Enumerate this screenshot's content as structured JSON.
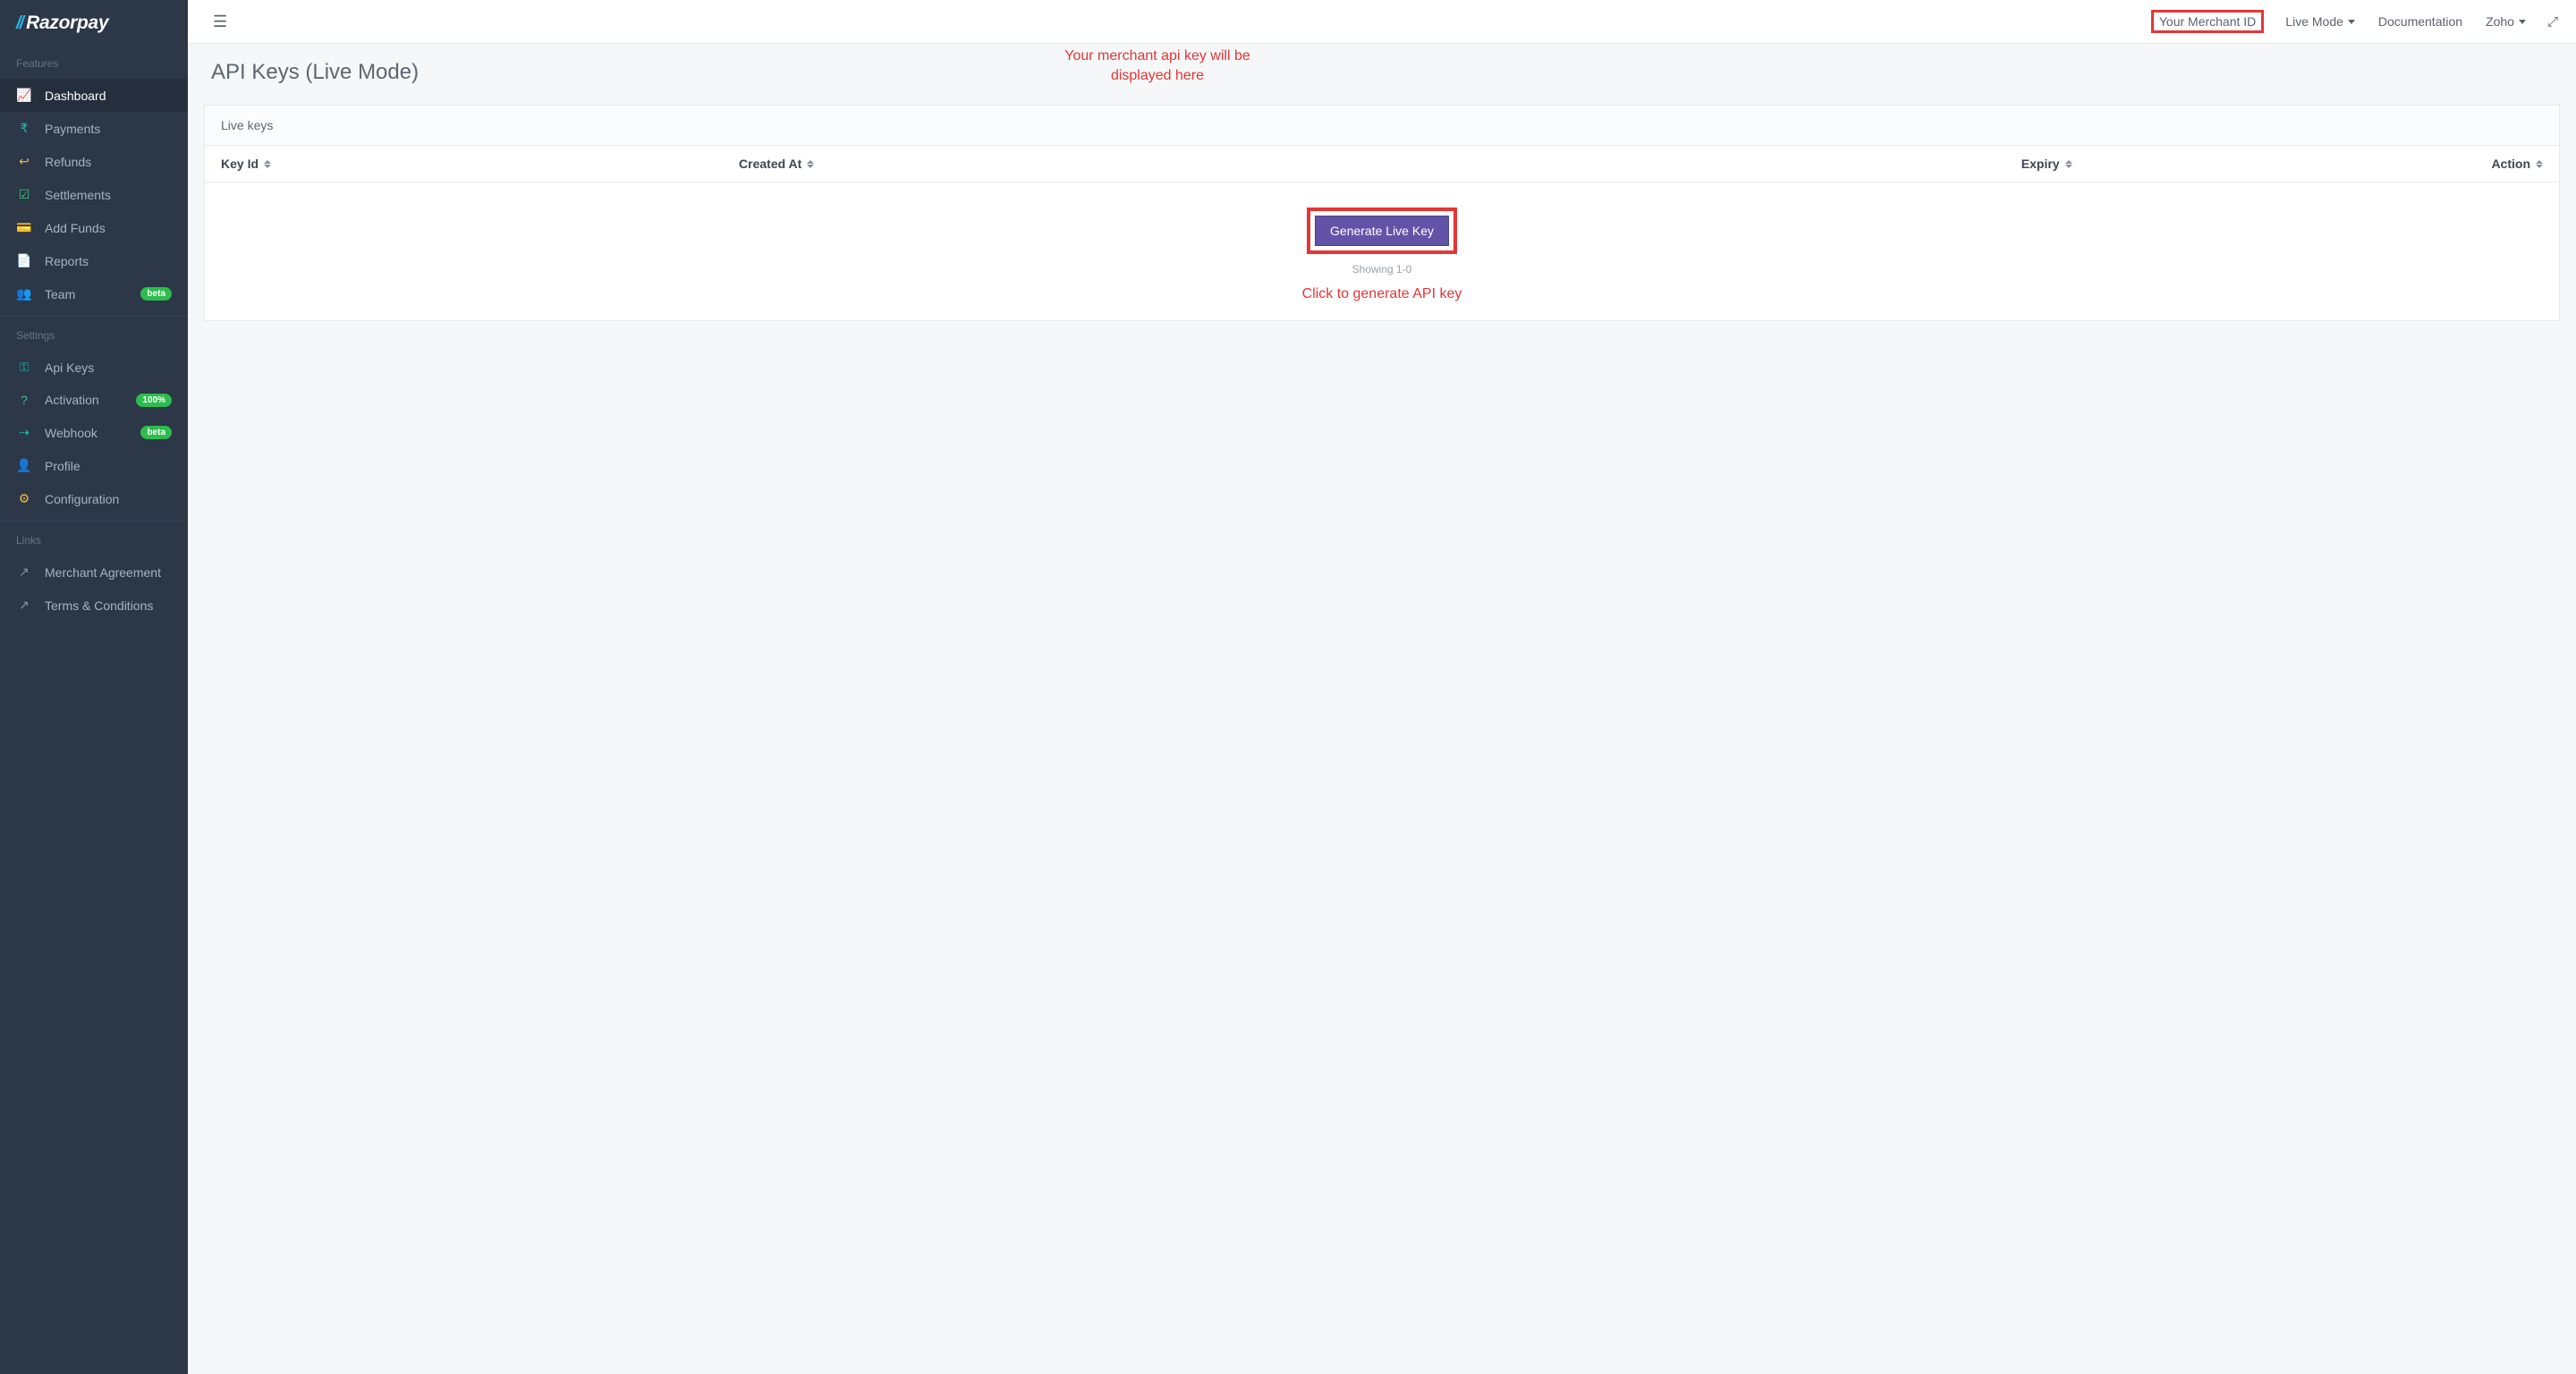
{
  "brand": {
    "name": "Razorpay"
  },
  "sidebar": {
    "sections": [
      {
        "label": "Features",
        "items": [
          {
            "label": "Dashboard",
            "icon": "area-chart",
            "color": "c-blue",
            "active": true
          },
          {
            "label": "Payments",
            "icon": "rupee",
            "color": "c-teal"
          },
          {
            "label": "Refunds",
            "icon": "undo",
            "color": "c-yellow"
          },
          {
            "label": "Settlements",
            "icon": "check-square",
            "color": "c-green"
          },
          {
            "label": "Add Funds",
            "icon": "wallet",
            "color": "c-indigo"
          },
          {
            "label": "Reports",
            "icon": "file",
            "color": "c-red"
          },
          {
            "label": "Team",
            "icon": "users",
            "color": "c-blue",
            "badge": "beta"
          }
        ]
      },
      {
        "label": "Settings",
        "items": [
          {
            "label": "Api Keys",
            "icon": "key",
            "color": "c-teal"
          },
          {
            "label": "Activation",
            "icon": "help",
            "color": "c-green",
            "badge": "100%"
          },
          {
            "label": "Webhook",
            "icon": "share",
            "color": "c-teal",
            "badge": "beta"
          },
          {
            "label": "Profile",
            "icon": "user",
            "color": "c-yellow"
          },
          {
            "label": "Configuration",
            "icon": "gear",
            "color": "c-yellow"
          }
        ]
      },
      {
        "label": "Links",
        "items": [
          {
            "label": "Merchant Agreement",
            "icon": "external",
            "color": "c-grey"
          },
          {
            "label": "Terms & Conditions",
            "icon": "external",
            "color": "c-grey"
          }
        ]
      }
    ]
  },
  "topbar": {
    "merchant_id": "Your Merchant ID",
    "mode": "Live Mode",
    "documentation": "Documentation",
    "account": "Zoho"
  },
  "page": {
    "title": "API Keys (Live Mode)"
  },
  "card": {
    "heading": "Live keys",
    "columns": [
      "Key Id",
      "Created At",
      "Expiry",
      "Action"
    ],
    "generate_label": "Generate Live Key",
    "showing": "Showing 1-0"
  },
  "annotations": {
    "merchant_note": "Your merchant api key will be displayed here",
    "generate_note": "Click to generate API key"
  }
}
